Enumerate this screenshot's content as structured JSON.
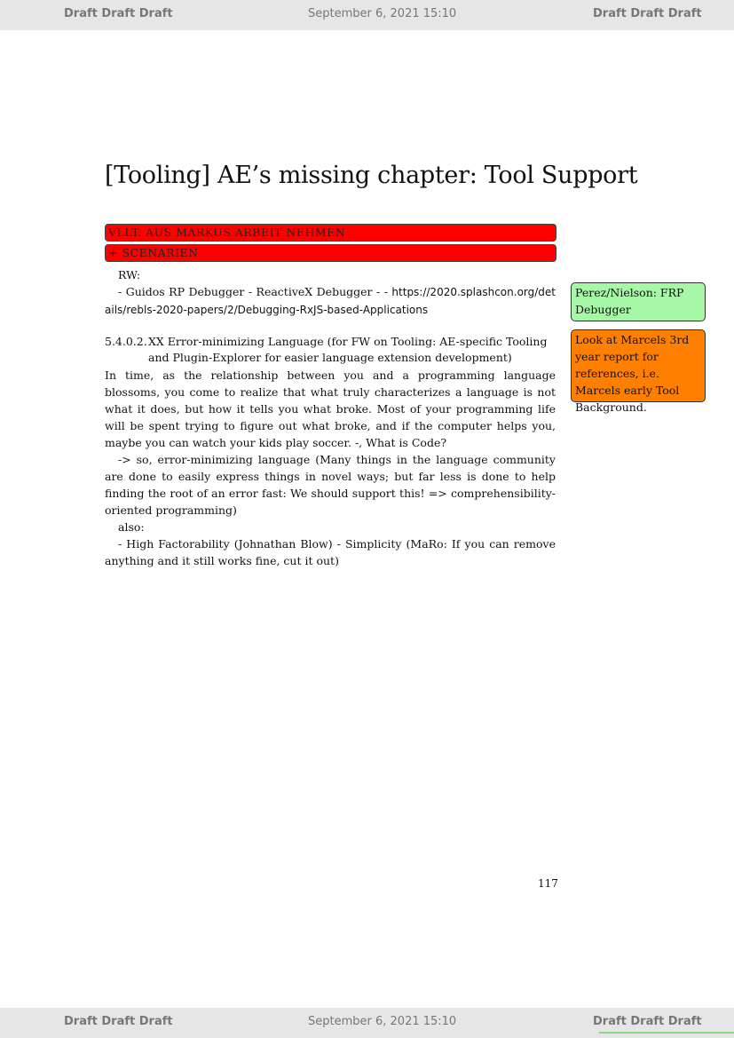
{
  "header": {
    "left": "Draft Draft Draft",
    "center": "September 6, 2021 15:10",
    "right": "Draft Draft Draft"
  },
  "footer": {
    "left": "Draft Draft Draft",
    "center": "September 6, 2021 15:10",
    "right": "Draft Draft Draft"
  },
  "chapter": {
    "title": "[Tooling] AE’s missing chapter: Tool Support"
  },
  "todos": [
    "VLLT. AUS MARKUS ARBEIT NEHMEN",
    "+ SCENARIEN"
  ],
  "content": {
    "rw_label": "RW:",
    "rw_line_prefix": "- Guidos RP Debugger - ReactiveX Debugger - - ",
    "rw_link": "https://2020.splashcon.org/details/rebls-2020-papers/2/Debugging-RxJS-based-Applications",
    "subsection_number": "5.4.0.2.",
    "subsection_title": "XX Error-minimizing Language (for FW on Tooling: AE-specific Tooling and Plugin-Explorer for easier language extension development)",
    "paragraph1": "In time, as the relationship between you and a programming language blossoms, you come to realize that what truly characterizes a language is not what it does, but how it tells you what broke. Most of your programming life will be spent trying to figure out what broke, and if the computer helps you, maybe you can watch your kids play soccer. -, What is Code?",
    "paragraph2": "-> so, error-minimizing language (Many things in the language community are done to easily express things in novel ways; but far less is done to help finding the root of an error fast: We should support this! => comprehensibility-oriented programming)",
    "also_label": "also:",
    "paragraph3": "- High Factorability (Johnathan Blow) - Simplicity (MaRo: If you can remove anything and it still works fine, cut it out)"
  },
  "margin_notes": [
    {
      "text": "Perez/Nielson: FRP Debugger",
      "color": "#a6f7a6"
    },
    {
      "text": "Look at Marcels 3rd year report for references, i.e. Marcels early Tool Background.",
      "color": "#ff8000"
    }
  ],
  "page_number": "117"
}
